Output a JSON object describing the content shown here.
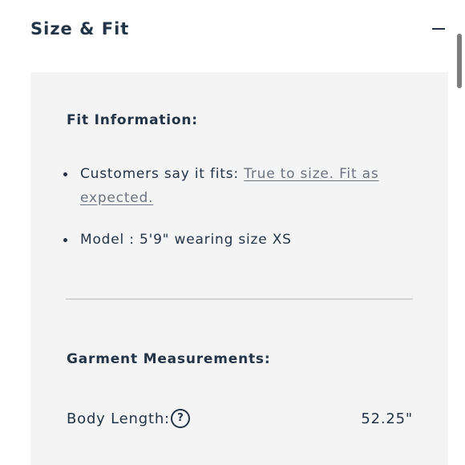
{
  "accordion": {
    "title": "Size & Fit",
    "collapse_icon": "minus-icon"
  },
  "fit_information": {
    "heading": "Fit Information:",
    "items": [
      {
        "prefix": "Customers say it fits: ",
        "link": "True to size. Fit as expected."
      },
      {
        "text": "Model : 5'9\" wearing size XS"
      }
    ]
  },
  "garment_measurements": {
    "heading": "Garment Measurements:",
    "rows": [
      {
        "label": "Body Length:",
        "help_icon": "?",
        "value": "52.25\""
      }
    ]
  },
  "colors": {
    "text": "#243447",
    "link": "#6b7480",
    "panel_background": "#f4f4f4"
  }
}
